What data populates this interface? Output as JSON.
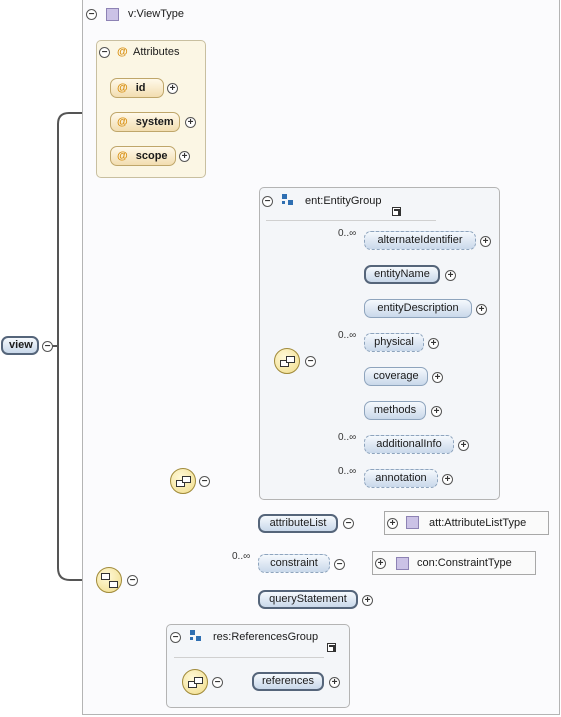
{
  "root": {
    "label": "view"
  },
  "view_type": {
    "label": "v:ViewType"
  },
  "attributes": {
    "title": "Attributes",
    "items": [
      "id",
      "system",
      "scope"
    ],
    "at_symbol": "@"
  },
  "entity_group": {
    "title": "ent:EntityGroup",
    "elements": [
      {
        "label": "alternateIdentifier",
        "occurrence": "0..∞"
      },
      {
        "label": "entityName",
        "occurrence": ""
      },
      {
        "label": "entityDescription",
        "occurrence": ""
      },
      {
        "label": "physical",
        "occurrence": "0..∞"
      },
      {
        "label": "coverage",
        "occurrence": ""
      },
      {
        "label": "methods",
        "occurrence": ""
      },
      {
        "label": "additionalInfo",
        "occurrence": "0..∞"
      },
      {
        "label": "annotation",
        "occurrence": "0..∞"
      }
    ]
  },
  "sequence_elements": {
    "attribute_list": {
      "label": "attributeList",
      "type": "att:AttributeListType"
    },
    "constraint": {
      "label": "constraint",
      "occurrence": "0..∞",
      "type": "con:ConstraintType"
    },
    "query_statement": {
      "label": "queryStatement"
    }
  },
  "references_group": {
    "title": "res:ReferencesGroup",
    "element": {
      "label": "references"
    }
  },
  "icons": {
    "collapse": "⊖",
    "expand": "⊕",
    "complex_type": "purple-square-icon",
    "group": "group-icon",
    "sequence": "sequence-compositor-icon",
    "choice": "choice-compositor-icon",
    "link": "jump-link-icon"
  },
  "colors": {
    "element_fill": "#c9d8ea",
    "attribute_fill": "#f2ddb0",
    "type_square": "#cbc2e6",
    "group_icon": "#2f6fb2",
    "compositor": "#f0dc8a"
  }
}
